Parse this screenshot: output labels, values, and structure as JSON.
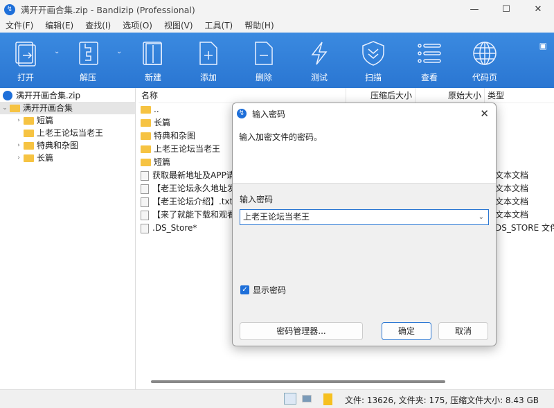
{
  "window": {
    "title": "满开开画合集.zip - Bandizip (Professional)",
    "minimize": "—",
    "maximize": "☐",
    "close": "✕"
  },
  "menu": [
    "文件(F)",
    "编辑(E)",
    "查找(I)",
    "选项(O)",
    "视图(V)",
    "工具(T)",
    "帮助(H)"
  ],
  "toolbar": [
    {
      "label": "打开",
      "icon": "open-icon"
    },
    {
      "label": "解压",
      "icon": "extract-icon"
    },
    {
      "label": "新建",
      "icon": "new-archive-icon"
    },
    {
      "label": "添加",
      "icon": "add-file-icon"
    },
    {
      "label": "删除",
      "icon": "delete-file-icon"
    },
    {
      "label": "测试",
      "icon": "lightning-icon"
    },
    {
      "label": "扫描",
      "icon": "shield-icon"
    },
    {
      "label": "查看",
      "icon": "list-icon"
    },
    {
      "label": "代码页",
      "icon": "globe-icon"
    }
  ],
  "tree": {
    "root": "满开开画合集.zip",
    "folder": "满开开画合集",
    "children": [
      "短篇",
      "上老王论坛当老王",
      "特典和杂图",
      "长篇"
    ]
  },
  "columns": [
    "名称",
    "压缩后大小",
    "原始大小",
    "类型"
  ],
  "files": [
    {
      "name": "..",
      "kind": "folder",
      "type": ""
    },
    {
      "name": "长篇",
      "kind": "folder",
      "type": ""
    },
    {
      "name": "特典和杂图",
      "kind": "folder",
      "type": ""
    },
    {
      "name": "上老王论坛当老王",
      "kind": "folder",
      "type": ""
    },
    {
      "name": "短篇",
      "kind": "folder",
      "type": ""
    },
    {
      "name": "获取最新地址及APP请",
      "kind": "text",
      "type": "文本文档"
    },
    {
      "name": "【老王论坛永久地址发",
      "kind": "text",
      "type": "文本文档"
    },
    {
      "name": "【老王论坛介绍】.txt",
      "kind": "text",
      "type": "文本文档"
    },
    {
      "name": "【来了就能下载和观看",
      "kind": "text",
      "type": "文本文档"
    },
    {
      "name": ".DS_Store*",
      "kind": "file",
      "type": "DS_STORE 文件"
    }
  ],
  "status": "文件: 13626, 文件夹: 175, 压缩文件大小: 8.43 GB",
  "dialog": {
    "title": "输入密码",
    "message": "输入加密文件的密码。",
    "label": "输入密码",
    "password": "上老王论坛当老王",
    "show_password": "显示密码",
    "manager": "密码管理器...",
    "ok": "确定",
    "cancel": "取消"
  }
}
